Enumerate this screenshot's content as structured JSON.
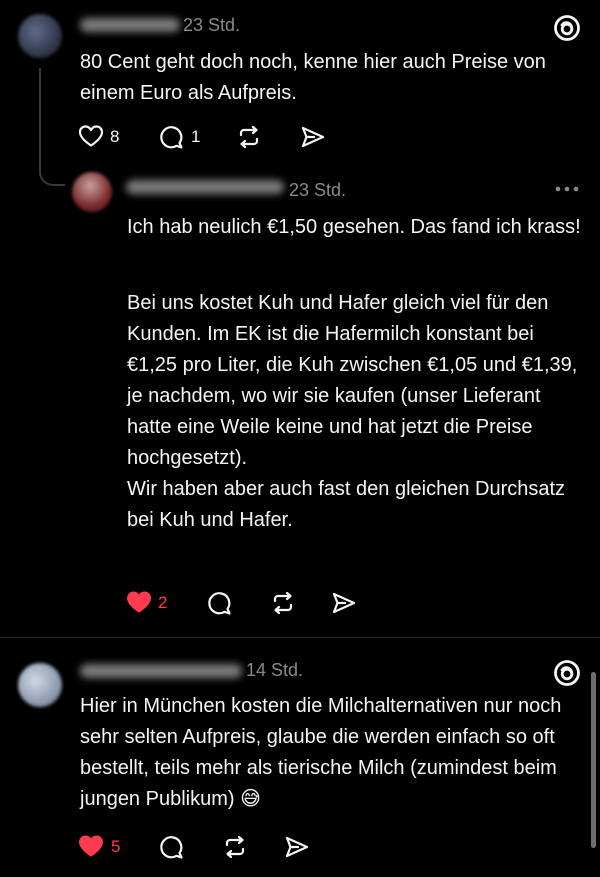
{
  "posts": [
    {
      "time": "23 Std.",
      "text": "80 Cent geht doch noch, kenne hier auch Preise von einem Euro als Aufpreis.",
      "likes": "8",
      "replies": "1"
    },
    {
      "time": "23 Std.",
      "paragraphs": [
        "Ich hab neulich €1,50 gesehen. Das fand ich krass!",
        "Bei uns kostet Kuh und Hafer gleich viel für den Kunden. Im EK ist die Hafermilch konstant bei €1,25 pro Liter, die Kuh zwischen €1,05 und €1,39, je nachdem, wo wir sie kaufen (unser Lieferant hatte eine Weile keine und hat jetzt die Preise hochgesetzt).\nWir haben aber auch fast den gleichen Durchsatz bei Kuh und Hafer."
      ],
      "likes": "2"
    },
    {
      "time": "14 Std.",
      "text": "Hier in München kosten die Milchalternativen nur noch sehr selten Aufpreis, glaube die werden einfach so oft bestellt, teils mehr als tierische Milch (zumindest beim jungen Publikum) 😅",
      "likes": "5"
    }
  ],
  "icons": {
    "threads": "threads-logo-icon",
    "like": "heart-icon",
    "reply": "speech-bubble-icon",
    "repost": "repost-icon",
    "share": "send-icon",
    "more": "more-icon"
  },
  "colors": {
    "background": "#000000",
    "text": "#f3f5f7",
    "muted": "#8a8a8a",
    "liked": "#ff3b4f"
  }
}
